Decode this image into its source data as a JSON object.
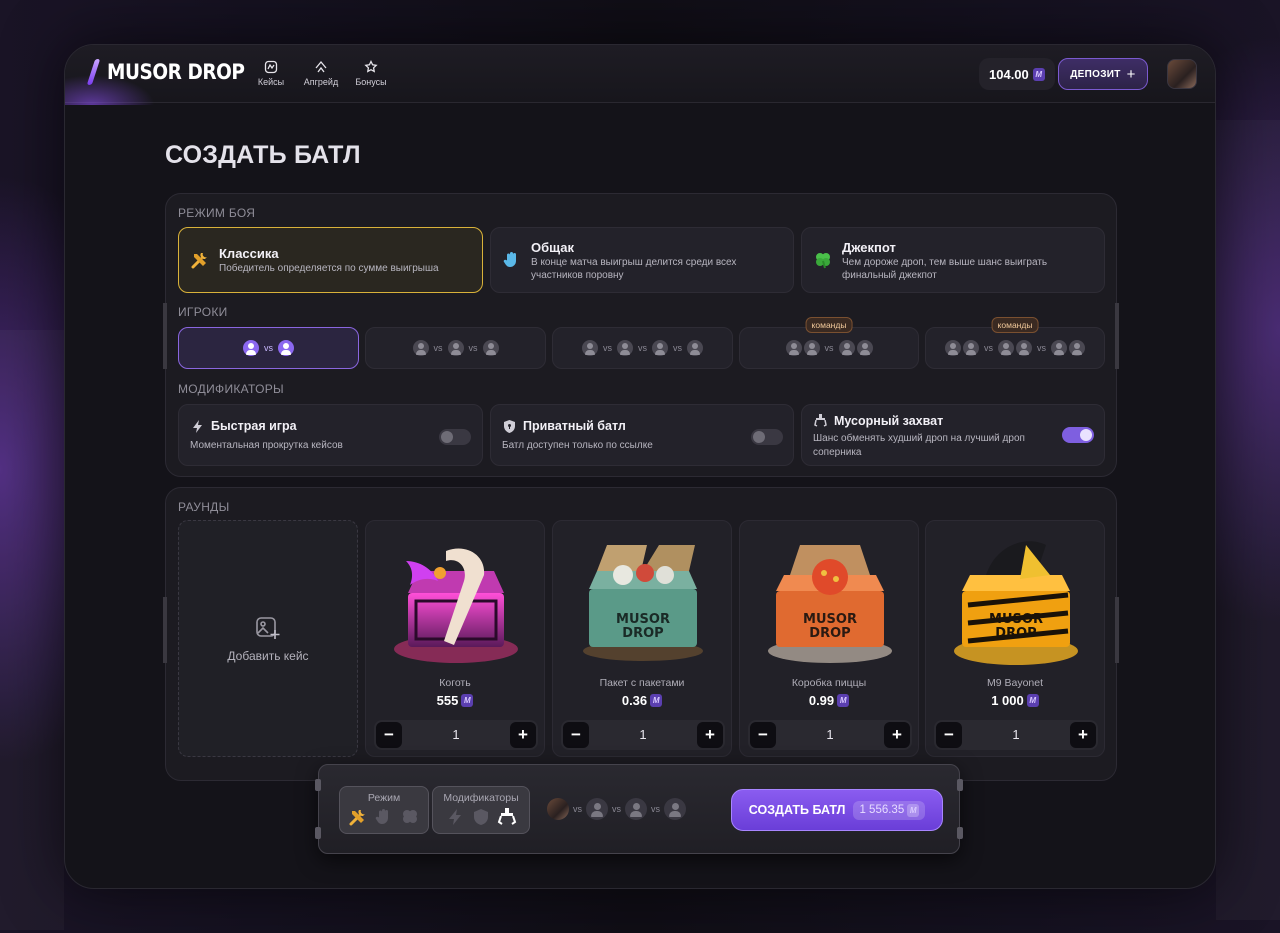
{
  "header": {
    "logo": "MUSOR DROP",
    "nav": [
      {
        "label": "Кейсы",
        "icon": "cases-icon"
      },
      {
        "label": "Апгрейд",
        "icon": "upgrade-icon"
      },
      {
        "label": "Бонусы",
        "icon": "bonus-icon"
      }
    ],
    "balance": "104.00",
    "currency_symbol": "M",
    "deposit_label": "ДЕПОЗИТ",
    "deposit_icon": "plus-icon"
  },
  "page_title": "СОЗДАТЬ БАТЛ",
  "battle_mode": {
    "label": "РЕЖИМ БОЯ",
    "options": [
      {
        "title": "Классика",
        "desc": "Победитель определяется по сумме выигрыша",
        "icon": "tools-icon",
        "selected": true
      },
      {
        "title": "Общак",
        "desc": "В конце матча выигрыш делится среди всех участников поровну",
        "icon": "hand-icon",
        "selected": false
      },
      {
        "title": "Джекпот",
        "desc": "Чем дороже дроп, тем выше шанс выиграть финальный джекпот",
        "icon": "clover-icon",
        "selected": false
      }
    ]
  },
  "players": {
    "label": "ИГРОКИ",
    "vs": "vs",
    "team_badge": "команды"
  },
  "modifiers": {
    "label": "МОДИФИКАТОРЫ",
    "items": [
      {
        "title": "Быстрая игра",
        "desc": "Моментальная прокрутка кейсов",
        "icon": "lightning-icon",
        "enabled": false
      },
      {
        "title": "Приватный батл",
        "desc": "Батл доступен только по ссылке",
        "icon": "shield-icon",
        "enabled": false
      },
      {
        "title": "Мусорный захват",
        "desc": "Шанс обменять худший дроп на лучший дроп соперника",
        "icon": "claw-icon",
        "enabled": true
      }
    ]
  },
  "rounds": {
    "label": "РАУНДЫ",
    "add_case_label": "Добавить кейс",
    "cases": [
      {
        "name": "Коготь",
        "price": "555",
        "qty": "1"
      },
      {
        "name": "Пакет с пакетами",
        "price": "0.36",
        "qty": "1"
      },
      {
        "name": "Коробка пиццы",
        "price": "0.99",
        "qty": "1"
      },
      {
        "name": "M9 Bayonet",
        "price": "1 000",
        "qty": "1"
      }
    ],
    "minus": "−",
    "plus": "+"
  },
  "bottom_bar": {
    "mode_label": "Режим",
    "modifiers_label": "Модификаторы",
    "vs": "vs",
    "create_label": "СОЗДАТЬ БАТЛ",
    "total_price": "1 556.35"
  },
  "colors": {
    "accent": "#8a5cf0",
    "selected_mode_border": "#d9b23a",
    "background": "#141319"
  }
}
